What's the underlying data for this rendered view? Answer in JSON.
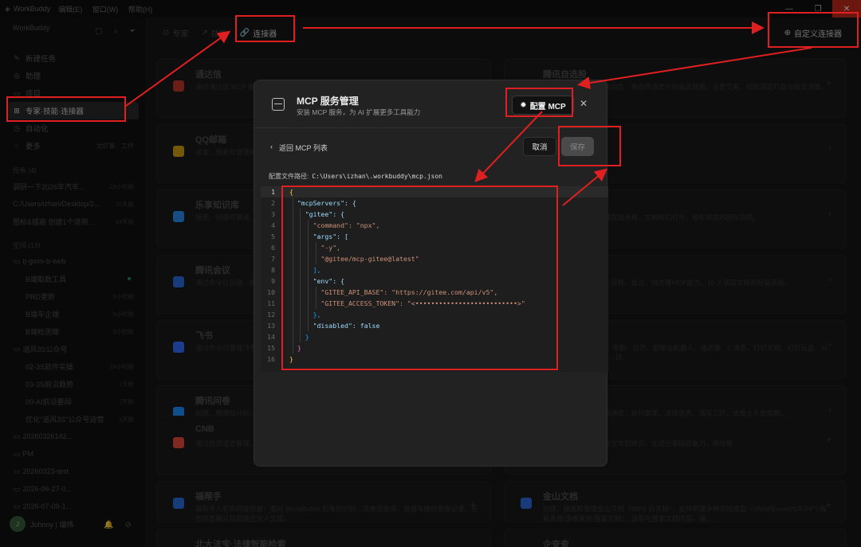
{
  "titlebar": {
    "app_name": "WorkBuddy",
    "menu": [
      "编辑(E)",
      "窗口(W)",
      "帮助(H)"
    ]
  },
  "sidebar": {
    "workspace": "WorkBuddy",
    "nav": [
      {
        "label": "新建任务",
        "icon": "edit-icon"
      },
      {
        "label": "助理",
        "icon": "assistant-icon"
      },
      {
        "label": "项目",
        "icon": "folder-icon"
      },
      {
        "label": "专家·技能·连接器",
        "icon": "apps-icon"
      },
      {
        "label": "自动化",
        "icon": "clock-icon"
      },
      {
        "label": "更多",
        "icon": "grid-icon",
        "sub": "龙虾集 · 工作"
      }
    ],
    "tasks_header": "任务 (4)",
    "tasks": [
      {
        "text": "调研一下2026年汽车...",
        "time": "23小时前"
      },
      {
        "text": "C:/Users/izhan/Desktop/2...",
        "time": "10天前"
      },
      {
        "text": "图标&插画 创建1个适用...",
        "time": "14天前"
      }
    ],
    "projects_header": "空间 (13)",
    "projects": [
      {
        "text": "tj-gwm-b-web",
        "indent": false,
        "time": ""
      },
      {
        "text": "B端取数工具",
        "indent": true,
        "time": "",
        "dot": true
      },
      {
        "text": "PRD更新",
        "indent": true,
        "time": "5小时前"
      },
      {
        "text": "B端车企端",
        "indent": true,
        "time": "5小时前"
      },
      {
        "text": "B端检测端",
        "indent": true,
        "time": "5小时前"
      },
      {
        "text": "追风3S公众号",
        "indent": false,
        "time": ""
      },
      {
        "text": "02-3S软件实操",
        "indent": true,
        "time": "16小时前"
      },
      {
        "text": "03-3S前沿趋势",
        "indent": true,
        "time": "1天前"
      },
      {
        "text": "00-AI前沿要闻",
        "indent": true,
        "time": "1天前"
      },
      {
        "text": "优化\"追风3S\"公众号运营",
        "indent": true,
        "time": "1天前"
      },
      {
        "text": "20260326142...",
        "indent": false,
        "time": ""
      },
      {
        "text": "PM",
        "indent": false,
        "time": ""
      },
      {
        "text": "20260323-test",
        "indent": false,
        "time": ""
      },
      {
        "text": "2026-06-27-0...",
        "indent": false,
        "time": ""
      },
      {
        "text": "2026-07-09-1...",
        "indent": false,
        "time": ""
      }
    ],
    "user": {
      "name": "Johnny | 瑞伟",
      "avatar_text": "J"
    }
  },
  "main": {
    "tabs": [
      {
        "label": "专家",
        "icon": "expert-icon"
      },
      {
        "label": "技能",
        "icon": "skill-icon"
      },
      {
        "label": "连接器",
        "icon": "link-icon"
      }
    ],
    "custom_connector": "自定义连接器",
    "cards": [
      {
        "name": "通达信",
        "desc": "通过通达信 MCP 服务...支持千个股基本...",
        "color": "#c0392b"
      },
      {
        "name": "腾讯自选股",
        "desc": "掌握毫秒级行情与资金动态，用自然语言分析自选数据、设置交易，轻松搞定盯盘与投资决策。",
        "color": "#2d6cdf"
      },
      {
        "name": "QQ邮箱",
        "desc": "收发、搜索和管理邮件...夹。",
        "color": "#d4a017"
      },
      {
        "name": "",
        "desc": "件，管理知识库详情。",
        "color": "#555"
      },
      {
        "name": "乐享知识库",
        "desc": "搜索、创建和管理...组团队文档的更新...",
        "color": "#2d8cf0"
      },
      {
        "name": "",
        "desc": "文档，用自然语言管理在线表格、文档和幻灯片，轻松完成内团队协同。",
        "color": "#555"
      },
      {
        "name": "腾讯会议",
        "desc": "通过命令行创建...会人员。",
        "color": "#2d6cdf"
      },
      {
        "name": "",
        "desc": "企业支持消息、文档、日程、会议、待办等MCP能力，10 人读取文档和智能表格。",
        "color": "#555"
      },
      {
        "name": "飞书",
        "desc": "通过命令行管理飞书...格、多维表格（Ba...",
        "color": "#3370ff"
      },
      {
        "name": "",
        "desc": "全产品能力：AI 表格、考勤、日历、群聊与机器人、通讯录、5 消息、钉钉文档、钉钉云盘、AI 听记、邮箱、OA 审批、日...",
        "color": "#555"
      },
      {
        "name": "腾讯问卷",
        "desc": "创建、管理和分析...",
        "color": "#1e90ff"
      },
      {
        "name": "",
        "desc": "需求和迭代，查询项目进度，拆分需求，流转状态，填写工时，查看全生命周期。",
        "color": "#555"
      },
      {
        "name": "CNB",
        "desc": "通过自然语言管理...",
        "color": "#e74c3c"
      },
      {
        "name": "",
        "desc": "云文件，并且提供上传文件到微云，生成分享链接能力，帮你管...",
        "color": "#555"
      },
      {
        "name": "福帮手",
        "desc": "福帮手人机协同连接器：面向 WorkBuddy 的身份识别、场景包查询、首值与继续使用记录。乐包状态确认和超级合伙人交接。",
        "color": "#2d6cdf"
      },
      {
        "name": "金山文档",
        "desc": "创建、搜索和管理金山文档（WPS 云文档），支持新建多种文档类型（Word/Excel/PDF/PPT/智能表格/多维表格/智能文档），读取与搜索文档内容，编...",
        "color": "#2d6cdf"
      },
      {
        "name": "北大法宝·法律智能检索",
        "desc": "",
        "color": "#555"
      },
      {
        "name": "企查查",
        "desc": "",
        "color": "#555"
      }
    ]
  },
  "modal": {
    "title": "MCP 服务管理",
    "subtitle": "安装 MCP 服务，为 AI 扩展更多工具能力",
    "config_button": "配置 MCP",
    "back_label": "返回 MCP 列表",
    "cancel": "取消",
    "save": "保存",
    "path_label": "配置文件路径:",
    "path_value": "C:\\Users\\izhan\\.workbuddy\\mcp.json",
    "code_lines": [
      "{",
      "  \"mcpServers\": {",
      "    \"gitee\": {",
      "      \"command\": \"npx\",",
      "      \"args\": [",
      "        \"-y\",",
      "        \"@gitee/mcp-gitee@latest\"",
      "      ],",
      "      \"env\": {",
      "        \"GITEE_API_BASE\": \"https://gitee.com/api/v5\",",
      "        \"GITEE_ACCESS_TOKEN\": \"<••••••••••••••••••••••••••>\"",
      "      },",
      "      \"disabled\": false",
      "    }",
      "  }",
      "}"
    ],
    "line_numbers": [
      "1",
      "2",
      "3",
      "4",
      "5",
      "6",
      "7",
      "8",
      "9",
      "10",
      "11",
      "12",
      "13",
      "14",
      "15",
      "16"
    ]
  },
  "annotation_color": "#e02020"
}
